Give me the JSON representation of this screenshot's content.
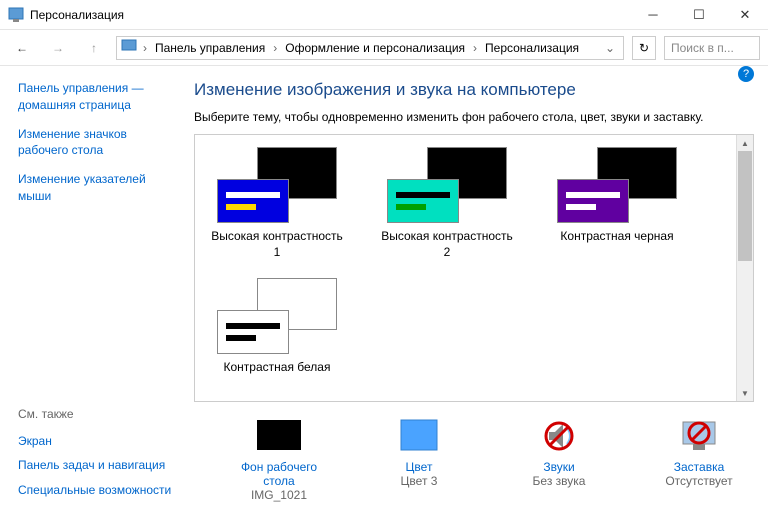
{
  "window": {
    "title": "Персонализация"
  },
  "breadcrumbs": {
    "b1": "Панель управления",
    "b2": "Оформление и персонализация",
    "b3": "Персонализация"
  },
  "search": {
    "placeholder": "Поиск в п..."
  },
  "sidebar": {
    "home": "Панель управления — домашняя страница",
    "link1": "Изменение значков рабочего стола",
    "link2": "Изменение указателей мыши",
    "also_label": "См. также",
    "also1": "Экран",
    "also2": "Панель задач и навигация",
    "also3": "Специальные возможности"
  },
  "main": {
    "heading": "Изменение изображения и звука на компьютере",
    "subtitle": "Выберите тему, чтобы одновременно изменить фон рабочего стола, цвет, звуки и заставку."
  },
  "themes": [
    {
      "label": "Высокая контрастность 1"
    },
    {
      "label": "Высокая контрастность 2"
    },
    {
      "label": "Контрастная черная"
    },
    {
      "label": "Контрастная белая"
    }
  ],
  "settings": {
    "bg": {
      "name": "Фон рабочего стола",
      "value": "IMG_1021"
    },
    "color": {
      "name": "Цвет",
      "value": "Цвет 3"
    },
    "sound": {
      "name": "Звуки",
      "value": "Без звука"
    },
    "saver": {
      "name": "Заставка",
      "value": "Отсутствует"
    }
  }
}
